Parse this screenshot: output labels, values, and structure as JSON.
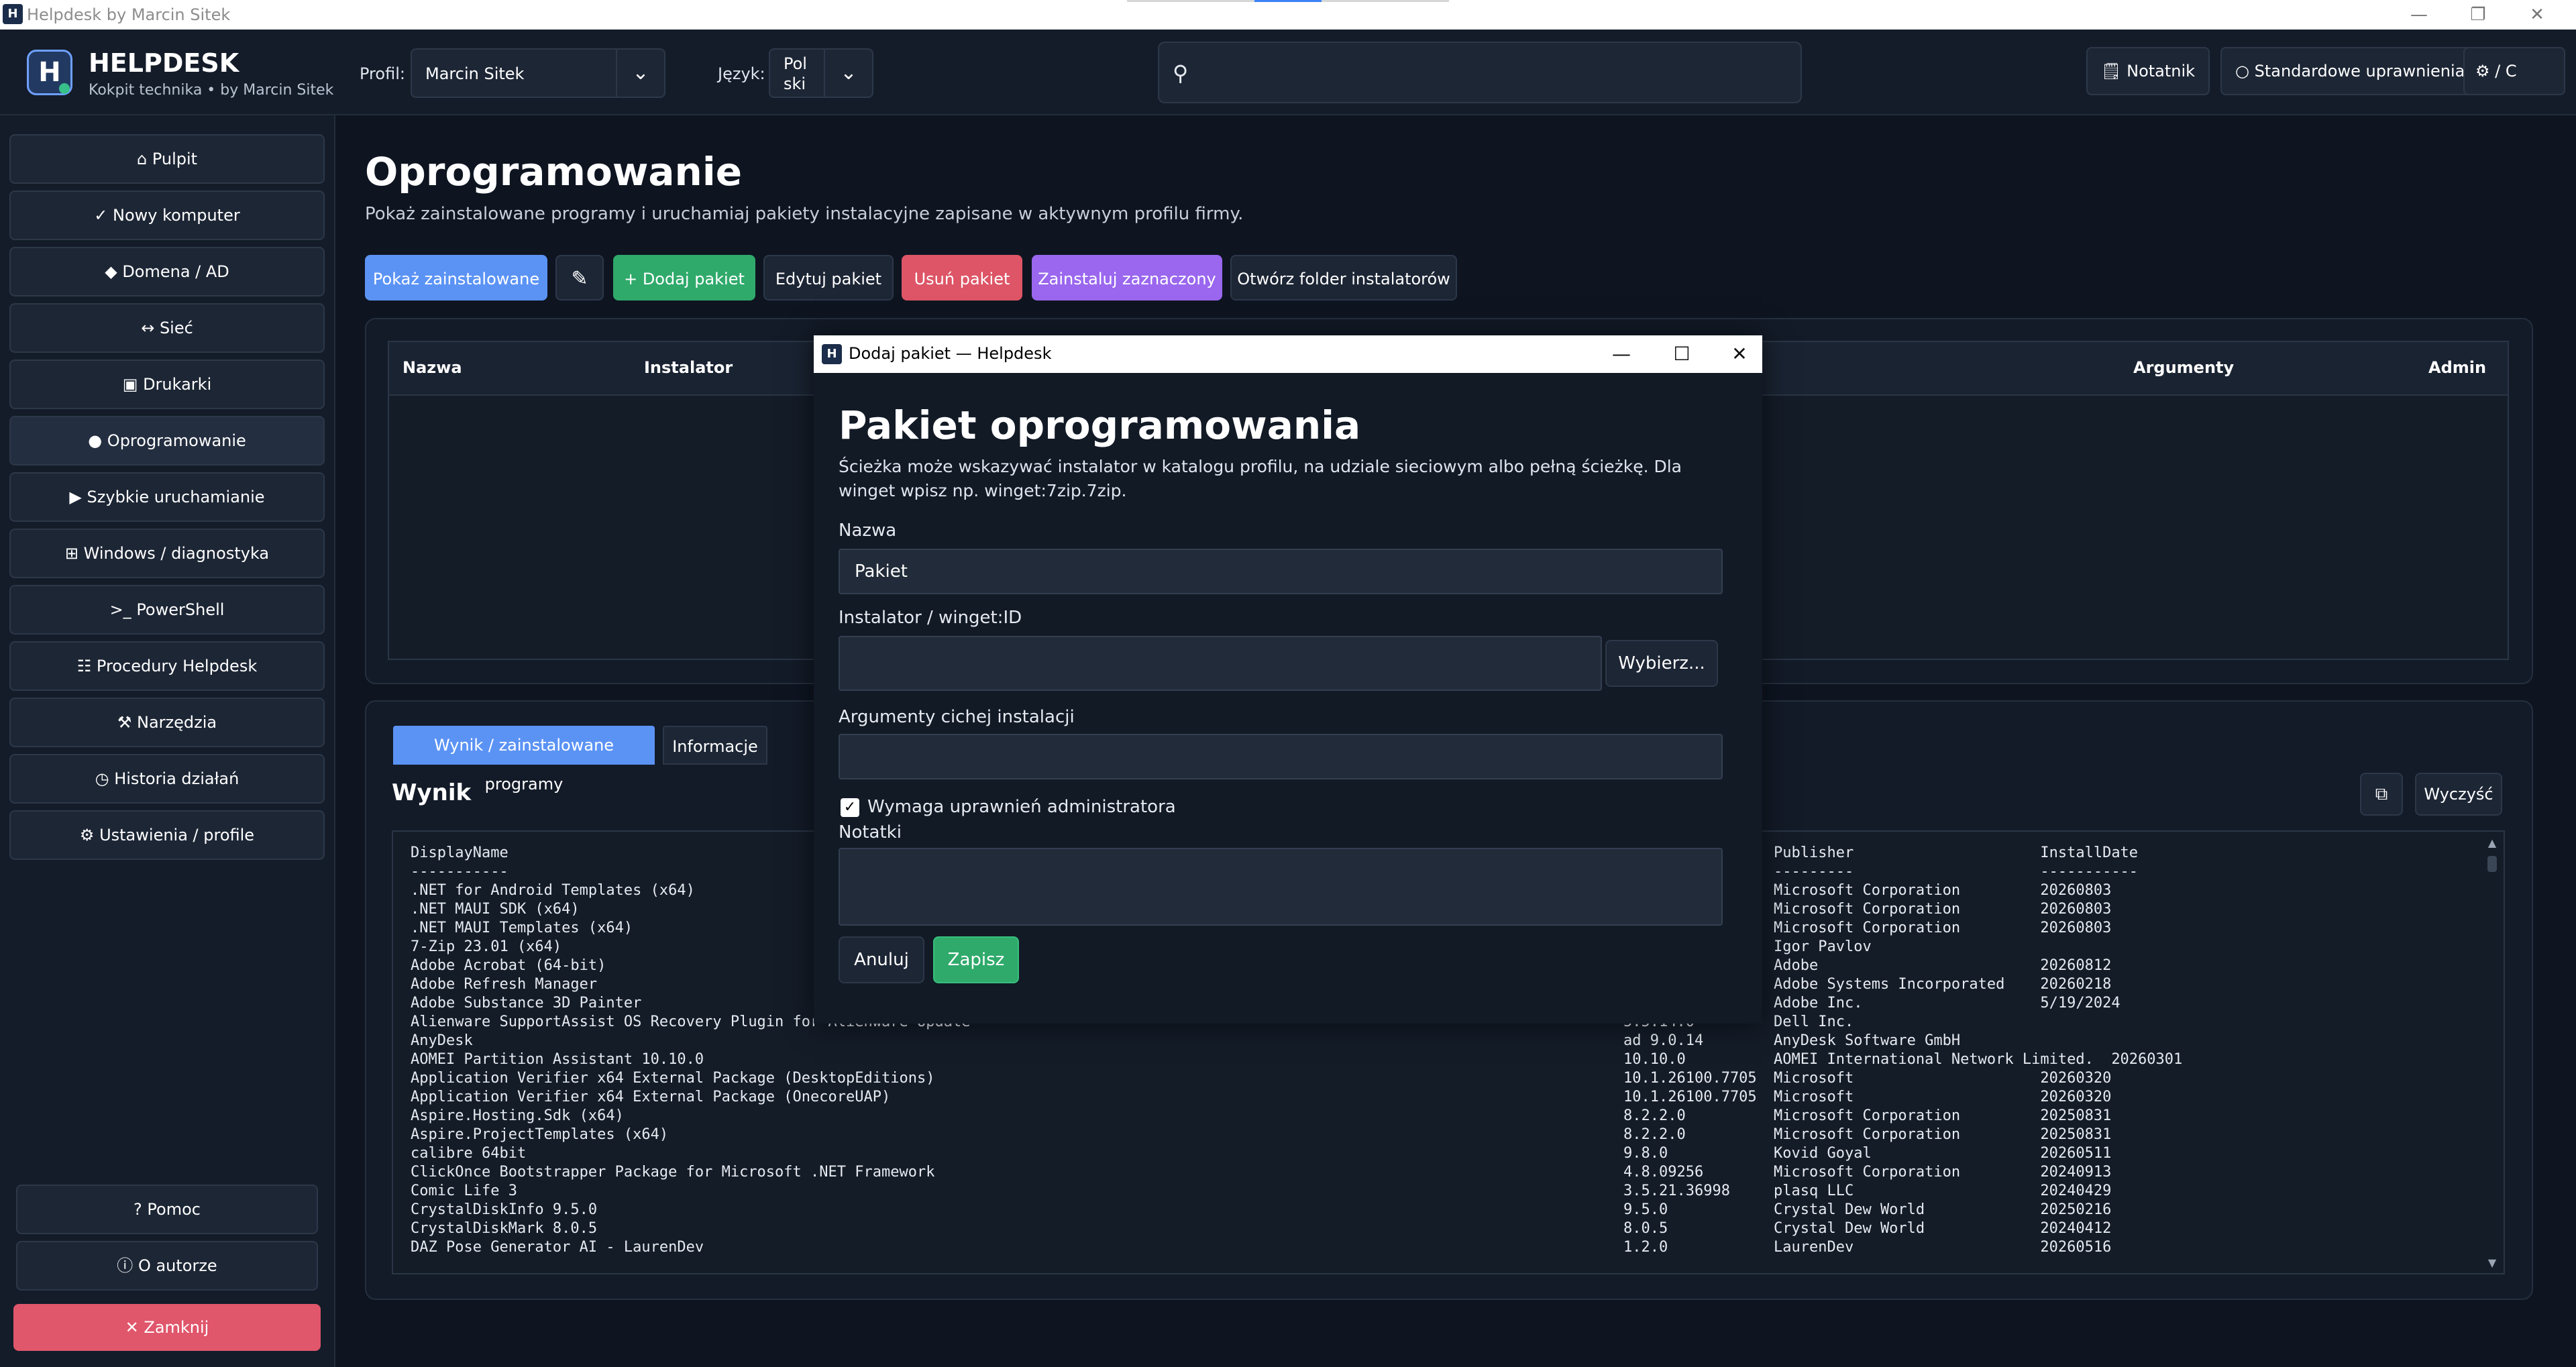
{
  "os_window": {
    "title": "Helpdesk by Marcin Sitek",
    "app_icon": "H",
    "min": "—",
    "max": "❐",
    "close": "✕"
  },
  "header": {
    "brand": "HELPDESK",
    "subtitle": "Kokpit technika • by Marcin Sitek",
    "profile_label": "Profil:",
    "profile_value": "Marcin Sitek",
    "language_label": "Język:",
    "language_value_line1": "Pol",
    "language_value_line2": "ski",
    "search_placeholder": "",
    "notepad_label": "Notatnik",
    "permissions_label": "Standardowe uprawnienia",
    "settings_label": "/ C"
  },
  "sidebar": {
    "items": [
      {
        "icon": "⌂",
        "label": "Pulpit"
      },
      {
        "icon": "✓",
        "label": "Nowy komputer"
      },
      {
        "icon": "◆",
        "label": "Domena / AD"
      },
      {
        "icon": "↔",
        "label": "Sieć"
      },
      {
        "icon": "▣",
        "label": "Drukarki"
      },
      {
        "icon": "●",
        "label": "Oprogramowanie"
      },
      {
        "icon": "▶",
        "label": "Szybkie uruchamianie"
      },
      {
        "icon": "⊞",
        "label": "Windows / diagnostyka"
      },
      {
        "icon": ">_",
        "label": "PowerShell"
      },
      {
        "icon": "☷",
        "label": "Procedury Helpdesk"
      },
      {
        "icon": "⚒",
        "label": "Narzędzia"
      },
      {
        "icon": "◷",
        "label": "Historia działań"
      },
      {
        "icon": "⚙",
        "label": "Ustawienia / profile"
      }
    ],
    "help": {
      "icon": "?",
      "label": "Pomoc"
    },
    "about": {
      "icon": "ⓘ",
      "label": "O autorze"
    },
    "close": {
      "icon": "✕",
      "label": "Zamknij"
    }
  },
  "main": {
    "title": "Oprogramowanie",
    "description": "Pokaż zainstalowane programy i uruchamiaj pakiety instalacyjne zapisane w aktywnym profilu firmy.",
    "toolbar": {
      "show_installed": "Pokaż zainstalowane",
      "add_package": "+ Dodaj pakiet",
      "edit_package": "Edytuj pakiet",
      "remove_package": "Usuń pakiet",
      "install_selected": "Zainstaluj zaznaczony",
      "open_folder": "Otwórz folder instalatorów"
    },
    "table_headers": {
      "name": "Nazwa",
      "installer": "Instalator",
      "arguments": "Argumenty",
      "admin": "Admin"
    },
    "tabs": {
      "result": "Wynik / zainstalowane programy",
      "info": "Informacje"
    },
    "result_title": "Wynik",
    "clear_label": "Wyczyść",
    "output_lines_left": [
      "DisplayName",
      "-----------",
      ".NET for Android Templates (x64)",
      ".NET MAUI SDK (x64)",
      ".NET MAUI Templates (x64)",
      "7-Zip 23.01 (x64)",
      "Adobe Acrobat (64-bit)",
      "Adobe Refresh Manager",
      "Adobe Substance 3D Painter",
      "Alienware SupportAssist OS Recovery Plugin for Alienware Update",
      "AnyDesk",
      "AOMEI Partition Assistant 10.10.0",
      "Application Verifier x64 External Package (DesktopEditions)",
      "Application Verifier x64 External Package (OnecoreUAP)",
      "Aspire.Hosting.Sdk (x64)",
      "Aspire.ProjectTemplates (x64)",
      "calibre 64bit",
      "ClickOnce Bootstrapper Package for Microsoft .NET Framework",
      "Comic Life 3",
      "CrystalDiskInfo 9.5.0",
      "CrystalDiskMark 8.0.5",
      "DAZ Pose Generator AI - LaurenDev"
    ],
    "output_lines_version": [
      "",
      "",
      "",
      "",
      "",
      "",
      "",
      "",
      "",
      "5.5.14.0",
      "ad 9.0.14",
      "10.10.0",
      "10.1.26100.7705",
      "10.1.26100.7705",
      "8.2.2.0",
      "8.2.2.0",
      "9.8.0",
      "4.8.09256",
      "3.5.21.36998",
      "9.5.0",
      "8.0.5",
      "1.2.0"
    ],
    "output_lines_right": [
      "Publisher                     InstallDate",
      "---------                     -----------",
      "Microsoft Corporation         20260803",
      "Microsoft Corporation         20260803",
      "Microsoft Corporation         20260803",
      "Igor Pavlov",
      "Adobe                         20260812",
      "Adobe Systems Incorporated    20260218",
      "Adobe Inc.                    5/19/2024",
      "Dell Inc.",
      "AnyDesk Software GmbH",
      "AOMEI International Network Limited.  20260301",
      "Microsoft                     20260320",
      "Microsoft                     20260320",
      "Microsoft Corporation         20250831",
      "Microsoft Corporation         20250831",
      "Kovid Goyal                   20260511",
      "Microsoft Corporation         20240913",
      "plasq LLC                     20240429",
      "Crystal Dew World             20250216",
      "Crystal Dew World             20240412",
      "LaurenDev                     20260516"
    ]
  },
  "dialog": {
    "title": "Dodaj pakiet — Helpdesk",
    "heading": "Pakiet oprogramowania",
    "description": "Ścieżka może wskazywać instalator w katalogu profilu, na udziale sieciowym albo pełną ścieżkę. Dla winget wpisz np. winget:7zip.7zip.",
    "name_label": "Nazwa",
    "name_value": "Pakiet",
    "installer_label": "Instalator / winget:ID",
    "installer_value": "",
    "browse_label": "Wybierz...",
    "args_label": "Argumenty cichej instalacji",
    "args_value": "",
    "admin_label": "Wymaga uprawnień administratora",
    "admin_checked": true,
    "notes_label": "Notatki",
    "cancel_label": "Anuluj",
    "save_label": "Zapisz"
  }
}
